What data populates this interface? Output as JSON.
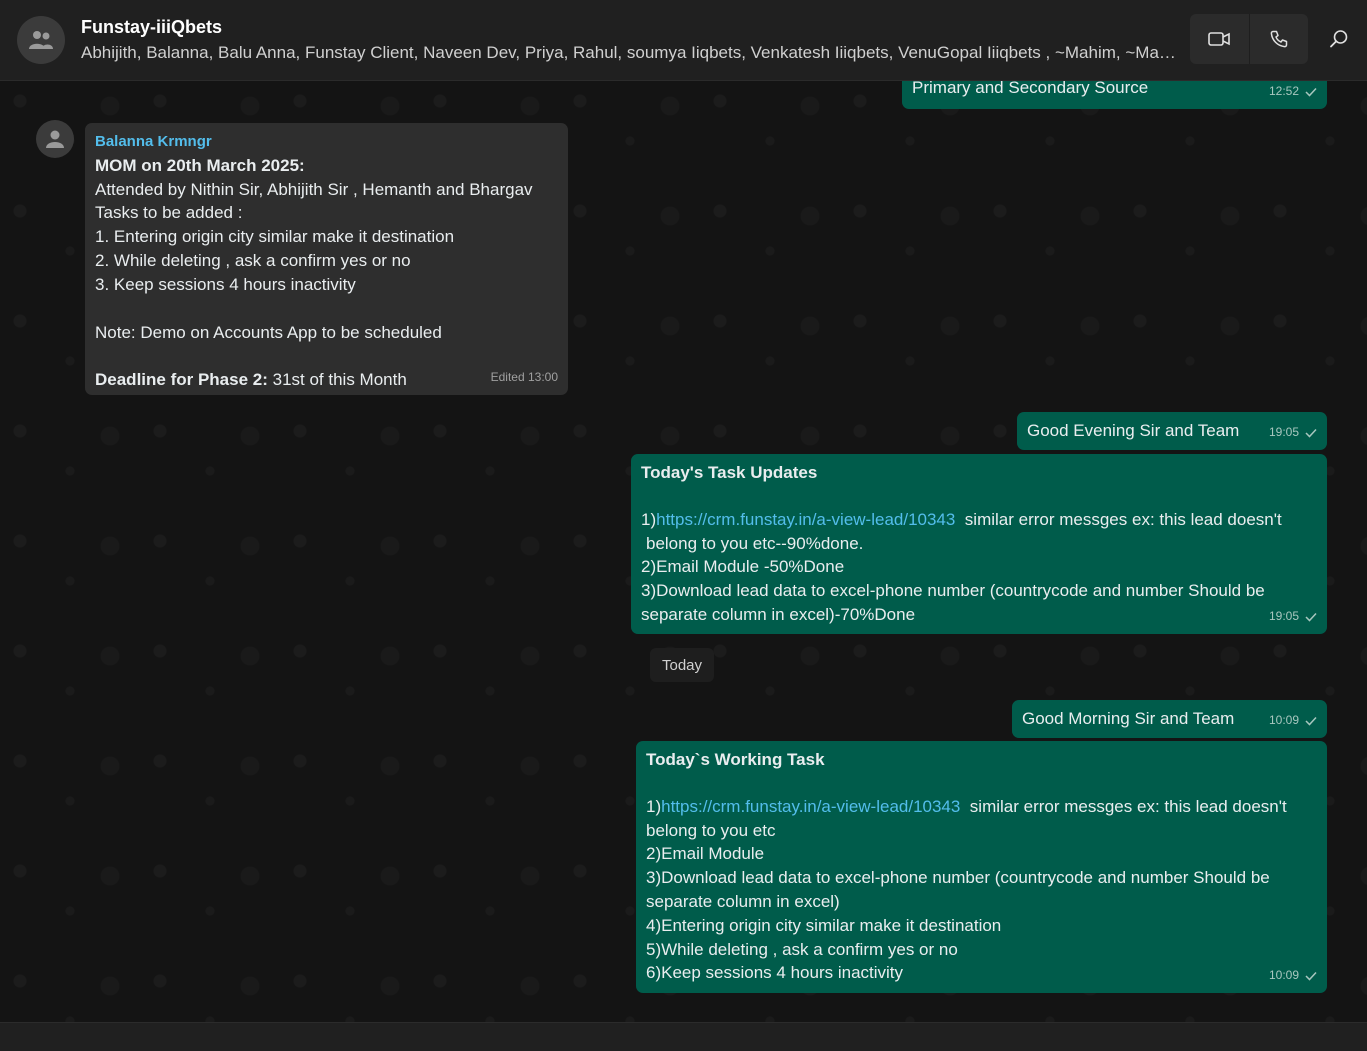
{
  "header": {
    "title": "Funstay-iiiQbets",
    "participants": "Abhijith, Balanna, Balu Anna, Funstay Client, Naveen Dev, Priya, Rahul, soumya Iiqbets, Venkatesh Iiiqbets, VenuGopal Iiiqbets , ~Mahim, ~Mahesh",
    "icons": [
      "group-avatar-icon",
      "video-call-icon",
      "voice-call-icon",
      "search-icon"
    ]
  },
  "messages": {
    "m0": {
      "text": "Primary and Secondary Source",
      "time": "12:52"
    },
    "m1": {
      "sender": "Balanna Krmngr",
      "title": "MOM on 20th March 2025:",
      "line1": "Attended by Nithin Sir, Abhijith Sir , Hemanth and Bhargav",
      "line2": "Tasks to be added :",
      "line3": "1. Entering origin city similar make it destination",
      "line4": "2. While deleting , ask a confirm yes or no",
      "line5": "3. Keep sessions 4 hours inactivity",
      "note": "Note: Demo on Accounts App to be scheduled",
      "deadline_label": "Deadline for Phase 2:",
      "deadline_value": " 31st of this Month",
      "time": "Edited 13:00"
    },
    "m2": {
      "text": "Good Evening Sir and Team",
      "time": "19:05"
    },
    "m3": {
      "title": "Today's Task Updates",
      "item1_prefix": "1)",
      "item1_link": "https://crm.funstay.in/a-view-lead/10343",
      "item1_rest": "  similar error messges ex: this lead doesn't belong to you etc--90%done.",
      "item2": "2)Email Module -50%Done",
      "item3": "3)Download lead data to excel-phone number (countrycode and number Should be separate column in excel)-70%Done",
      "time": "19:05"
    },
    "date_separator": "Today",
    "m4": {
      "text": "Good Morning Sir and Team",
      "time": "10:09"
    },
    "m5": {
      "title": "Today`s Working Task",
      "item1_prefix": "1)",
      "item1_link": "https://crm.funstay.in/a-view-lead/10343",
      "item1_rest": "  similar error messges ex: this lead doesn't belong to you etc",
      "item2": "2)Email Module",
      "item3": "3)Download lead data to excel-phone number (countrycode and number Should be separate column in excel)",
      "item4": "4)Entering origin city similar make it destination",
      "item5": "5)While deleting , ask a confirm yes or no",
      "item6": "6)Keep sessions 4 hours inactivity",
      "time": "10:09"
    }
  },
  "colors": {
    "outgoing_bubble": "#005c4b",
    "incoming_bubble": "#2e2e2e",
    "link": "#53bdeb",
    "background": "#141414"
  }
}
